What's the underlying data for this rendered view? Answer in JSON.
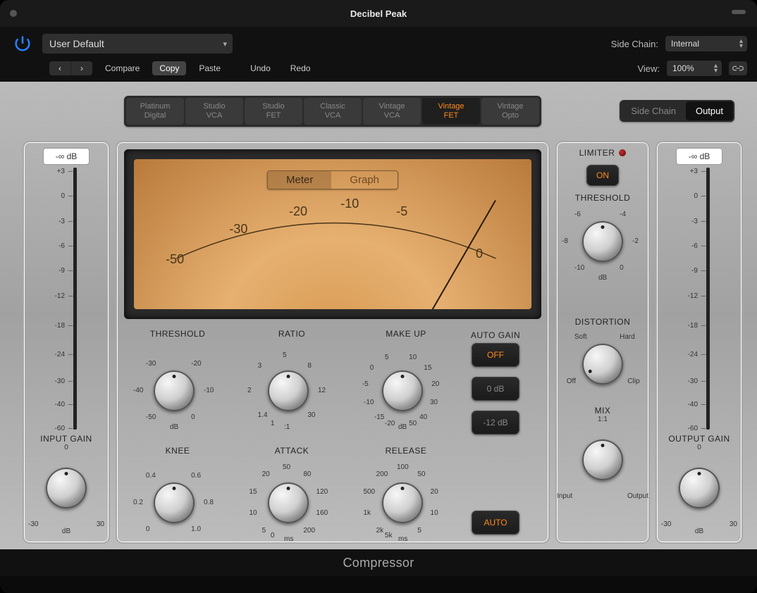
{
  "window": {
    "title": "Decibel Peak"
  },
  "toolbar": {
    "preset": "User Default",
    "sidechain_label": "Side Chain:",
    "sidechain_value": "Internal",
    "compare": "Compare",
    "copy": "Copy",
    "paste": "Paste",
    "undo": "Undo",
    "redo": "Redo",
    "view_label": "View:",
    "view_value": "100%"
  },
  "models": [
    {
      "l1": "Platinum",
      "l2": "Digital"
    },
    {
      "l1": "Studio",
      "l2": "VCA"
    },
    {
      "l1": "Studio",
      "l2": "FET"
    },
    {
      "l1": "Classic",
      "l2": "VCA"
    },
    {
      "l1": "Vintage",
      "l2": "VCA"
    },
    {
      "l1": "Vintage",
      "l2": "FET"
    },
    {
      "l1": "Vintage",
      "l2": "Opto"
    }
  ],
  "model_active_index": 5,
  "sc_output": {
    "sidechain": "Side Chain",
    "output": "Output",
    "active": "output"
  },
  "input": {
    "readout": "-∞ dB",
    "label": "INPUT GAIN",
    "unit": "dB",
    "ticks": [
      "+3",
      "0",
      "-3",
      "-6",
      "-9",
      "-12",
      "-18",
      "-24",
      "-30",
      "-40",
      "-60"
    ],
    "knob": {
      "min": "-30",
      "top": "0",
      "max": "30"
    }
  },
  "output": {
    "readout": "-∞ dB",
    "label": "OUTPUT GAIN",
    "unit": "dB",
    "ticks": [
      "+3",
      "0",
      "-3",
      "-6",
      "-9",
      "-12",
      "-18",
      "-24",
      "-30",
      "-40",
      "-60"
    ],
    "knob": {
      "min": "-30",
      "top": "0",
      "max": "30"
    }
  },
  "vu": {
    "tabs": {
      "meter": "Meter",
      "graph": "Graph",
      "active": "meter"
    },
    "scale": [
      "-50",
      "-30",
      "-20",
      "-10",
      "-5",
      "0"
    ]
  },
  "knobs": {
    "threshold": {
      "label": "THRESHOLD",
      "unit": "dB",
      "ticks": [
        "-30",
        "-20",
        "-40",
        "-10",
        "-50",
        "0"
      ]
    },
    "ratio": {
      "label": "RATIO",
      "unit": ":1",
      "ticks": [
        "5",
        "3",
        "8",
        "2",
        "12",
        "1.4",
        "30",
        "1"
      ]
    },
    "makeup": {
      "label": "MAKE UP",
      "unit": "dB",
      "ticks": [
        "5",
        "10",
        "0",
        "15",
        "-5",
        "20",
        "-10",
        "30",
        "-15",
        "40",
        "-20",
        "50"
      ]
    },
    "knee": {
      "label": "KNEE",
      "ticks": [
        "0.4",
        "0.6",
        "0.2",
        "0.8",
        "0",
        "1.0"
      ]
    },
    "attack": {
      "label": "ATTACK",
      "unit": "ms",
      "ticks": [
        "50",
        "20",
        "80",
        "15",
        "120",
        "10",
        "160",
        "5",
        "200",
        "0"
      ]
    },
    "release": {
      "label": "RELEASE",
      "unit": "ms",
      "ticks": [
        "100",
        "200",
        "50",
        "500",
        "20",
        "1k",
        "10",
        "2k",
        "5",
        "5k"
      ]
    }
  },
  "autogain": {
    "label": "AUTO GAIN",
    "off": "OFF",
    "zero": "0 dB",
    "neg12": "-12 dB",
    "auto": "AUTO"
  },
  "limiter": {
    "label": "LIMITER",
    "on": "ON",
    "threshold": {
      "label": "THRESHOLD",
      "unit": "dB",
      "ticks": [
        "-6",
        "-4",
        "-8",
        "-2",
        "-10",
        "0"
      ]
    },
    "distortion": {
      "label": "DISTORTION",
      "ticks": [
        "Soft",
        "Hard",
        "Off",
        "Clip"
      ]
    },
    "mix": {
      "label": "MIX",
      "top": "1:1",
      "left": "Input",
      "right": "Output"
    }
  },
  "footer": "Compressor"
}
